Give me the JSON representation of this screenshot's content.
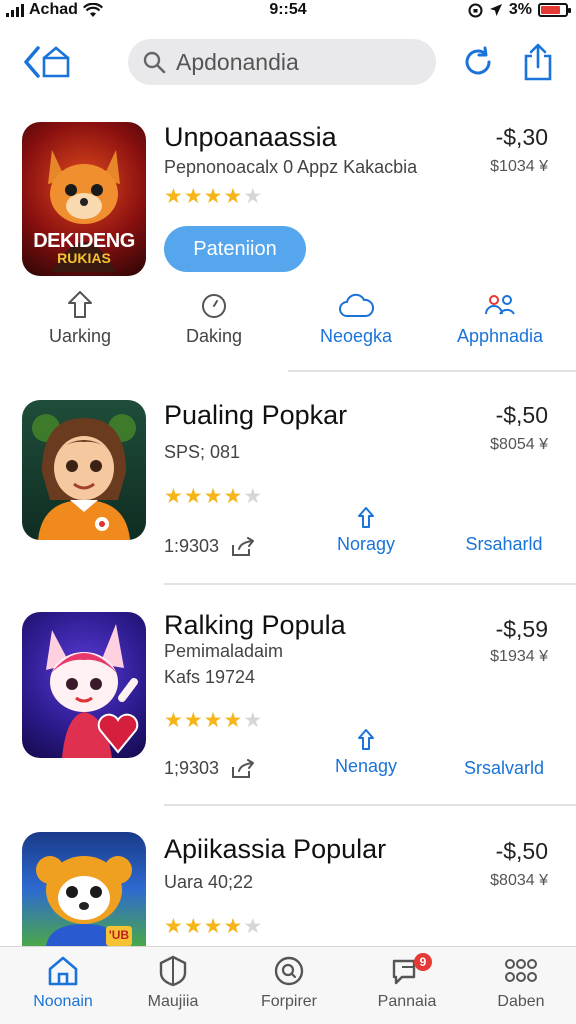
{
  "status": {
    "carrier": "Achad",
    "time": "9::54",
    "battery": "3%",
    "battery_level": 0.8
  },
  "search": {
    "value": "Apdonandia"
  },
  "apps": [
    {
      "title": "Unpoanaassia",
      "subtitle": "Pepnonoacalx 0 Appz Kakacbia",
      "price": "-$,30",
      "price_sub": "$1034 ¥",
      "rating": 4,
      "icon_text_1": "DEKIDENG",
      "icon_text_2": "RUKIAS",
      "get_label": "Pateniion",
      "actions": [
        "Uarking",
        "Daking",
        "Neoegka",
        "Apphnadia"
      ]
    },
    {
      "title": "Pualing Popkar",
      "subtitle": "SPS; 081",
      "price": "-$,50",
      "price_sub": "$8054 ¥",
      "rating": 4,
      "stat": "1:9303",
      "link_1": "Noragy",
      "link_2": "Srsaharld"
    },
    {
      "title": "Ralking Popula",
      "subtitle": "Pemimaladaim",
      "subtitle_2": "Kafs 19724",
      "price": "-$,59",
      "price_sub": "$1934 ¥",
      "rating": 4,
      "stat": "1;9303",
      "link_1": "Nenagy",
      "link_2": "Srsalvarld"
    },
    {
      "title": "Apiikassia Popular",
      "subtitle": "Uara 40;22",
      "price": "-$,50",
      "price_sub": "$8034 ¥",
      "rating": 4,
      "icon_badge": "'UB"
    }
  ],
  "tabs": [
    {
      "label": "Noonain",
      "icon": "home-icon"
    },
    {
      "label": "Maujiia",
      "icon": "shield-icon"
    },
    {
      "label": "Forpirer",
      "icon": "search-circle-icon"
    },
    {
      "label": "Pannaia",
      "icon": "chat-icon",
      "badge": "9"
    },
    {
      "label": "Daben",
      "icon": "grid-icon"
    }
  ],
  "colors": {
    "accent": "#1a73d9",
    "button": "#56a6ee",
    "star": "#f5b51b",
    "badge": "#e53935"
  }
}
